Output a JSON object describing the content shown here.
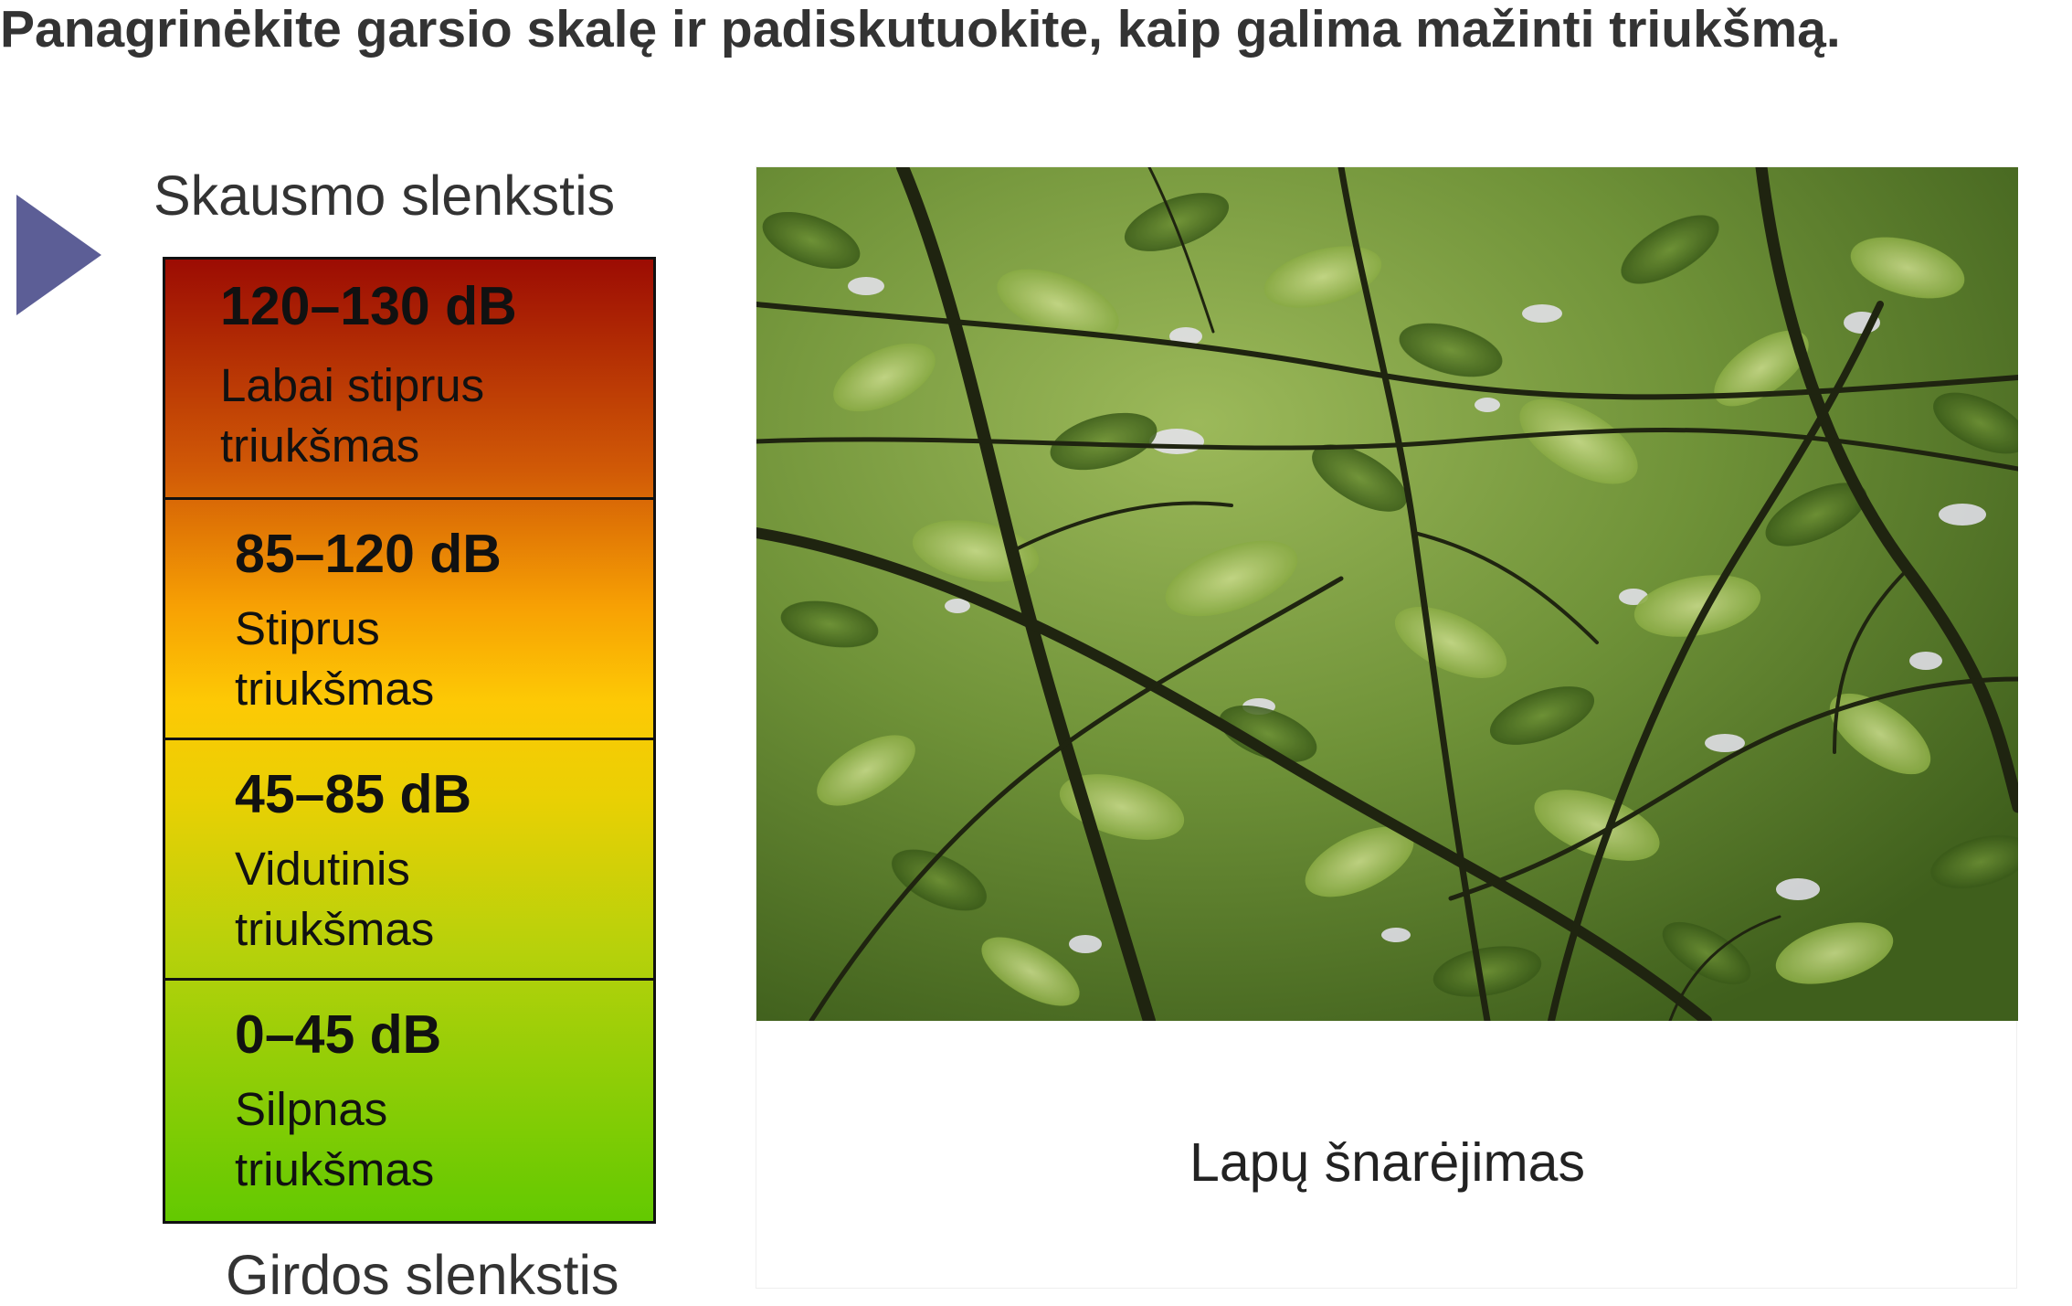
{
  "heading": "Panagrinėkite garsio skalę ir padiskutuokite, kaip galima mažinti triukšmą.",
  "pointer_icon": "triangle-right-icon",
  "scale": {
    "top_label": "Skausmo slenkstis",
    "bottom_label": "Girdos slenkstis",
    "bands": [
      {
        "range": "120–130 dB",
        "description": "Labai stiprus triukšmas",
        "color": "#b63c04"
      },
      {
        "range": "85–120 dB",
        "description": "Stiprus triukšmas",
        "color": "#f39a05"
      },
      {
        "range": "45–85 dB",
        "description": "Vidutinis triukšmas",
        "color": "#e2d004"
      },
      {
        "range": "0–45 dB",
        "description": "Silpnas triukšmas",
        "color": "#7fcc05"
      }
    ]
  },
  "photo": {
    "subject": "tree-canopy-leaves",
    "caption": "Lapų šnarėjimas"
  },
  "colors": {
    "pointer": "#5c5e96",
    "scale_top": "#9c0c03",
    "scale_bottom": "#63c901"
  }
}
